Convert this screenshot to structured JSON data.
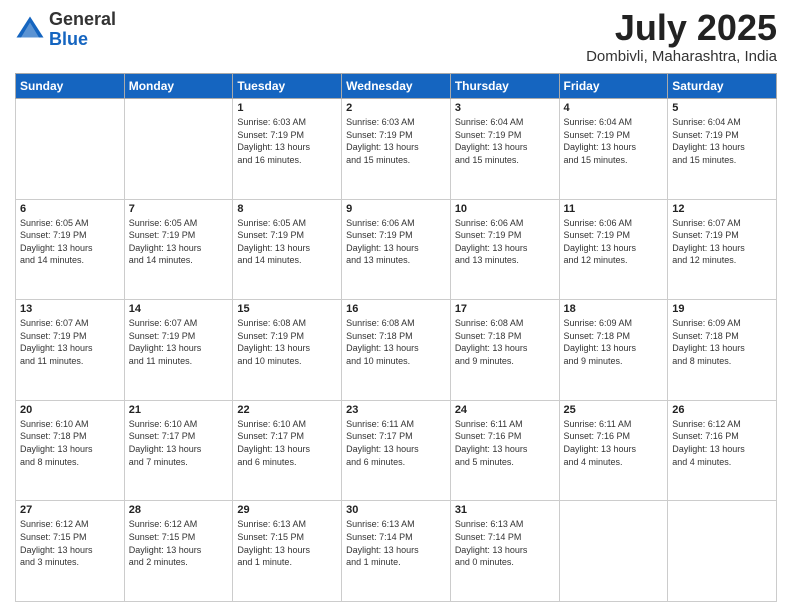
{
  "header": {
    "logo_general": "General",
    "logo_blue": "Blue",
    "month_year": "July 2025",
    "location": "Dombivli, Maharashtra, India"
  },
  "days_of_week": [
    "Sunday",
    "Monday",
    "Tuesday",
    "Wednesday",
    "Thursday",
    "Friday",
    "Saturday"
  ],
  "weeks": [
    [
      {
        "day": "",
        "info": ""
      },
      {
        "day": "",
        "info": ""
      },
      {
        "day": "1",
        "info": "Sunrise: 6:03 AM\nSunset: 7:19 PM\nDaylight: 13 hours\nand 16 minutes."
      },
      {
        "day": "2",
        "info": "Sunrise: 6:03 AM\nSunset: 7:19 PM\nDaylight: 13 hours\nand 15 minutes."
      },
      {
        "day": "3",
        "info": "Sunrise: 6:04 AM\nSunset: 7:19 PM\nDaylight: 13 hours\nand 15 minutes."
      },
      {
        "day": "4",
        "info": "Sunrise: 6:04 AM\nSunset: 7:19 PM\nDaylight: 13 hours\nand 15 minutes."
      },
      {
        "day": "5",
        "info": "Sunrise: 6:04 AM\nSunset: 7:19 PM\nDaylight: 13 hours\nand 15 minutes."
      }
    ],
    [
      {
        "day": "6",
        "info": "Sunrise: 6:05 AM\nSunset: 7:19 PM\nDaylight: 13 hours\nand 14 minutes."
      },
      {
        "day": "7",
        "info": "Sunrise: 6:05 AM\nSunset: 7:19 PM\nDaylight: 13 hours\nand 14 minutes."
      },
      {
        "day": "8",
        "info": "Sunrise: 6:05 AM\nSunset: 7:19 PM\nDaylight: 13 hours\nand 14 minutes."
      },
      {
        "day": "9",
        "info": "Sunrise: 6:06 AM\nSunset: 7:19 PM\nDaylight: 13 hours\nand 13 minutes."
      },
      {
        "day": "10",
        "info": "Sunrise: 6:06 AM\nSunset: 7:19 PM\nDaylight: 13 hours\nand 13 minutes."
      },
      {
        "day": "11",
        "info": "Sunrise: 6:06 AM\nSunset: 7:19 PM\nDaylight: 13 hours\nand 12 minutes."
      },
      {
        "day": "12",
        "info": "Sunrise: 6:07 AM\nSunset: 7:19 PM\nDaylight: 13 hours\nand 12 minutes."
      }
    ],
    [
      {
        "day": "13",
        "info": "Sunrise: 6:07 AM\nSunset: 7:19 PM\nDaylight: 13 hours\nand 11 minutes."
      },
      {
        "day": "14",
        "info": "Sunrise: 6:07 AM\nSunset: 7:19 PM\nDaylight: 13 hours\nand 11 minutes."
      },
      {
        "day": "15",
        "info": "Sunrise: 6:08 AM\nSunset: 7:19 PM\nDaylight: 13 hours\nand 10 minutes."
      },
      {
        "day": "16",
        "info": "Sunrise: 6:08 AM\nSunset: 7:18 PM\nDaylight: 13 hours\nand 10 minutes."
      },
      {
        "day": "17",
        "info": "Sunrise: 6:08 AM\nSunset: 7:18 PM\nDaylight: 13 hours\nand 9 minutes."
      },
      {
        "day": "18",
        "info": "Sunrise: 6:09 AM\nSunset: 7:18 PM\nDaylight: 13 hours\nand 9 minutes."
      },
      {
        "day": "19",
        "info": "Sunrise: 6:09 AM\nSunset: 7:18 PM\nDaylight: 13 hours\nand 8 minutes."
      }
    ],
    [
      {
        "day": "20",
        "info": "Sunrise: 6:10 AM\nSunset: 7:18 PM\nDaylight: 13 hours\nand 8 minutes."
      },
      {
        "day": "21",
        "info": "Sunrise: 6:10 AM\nSunset: 7:17 PM\nDaylight: 13 hours\nand 7 minutes."
      },
      {
        "day": "22",
        "info": "Sunrise: 6:10 AM\nSunset: 7:17 PM\nDaylight: 13 hours\nand 6 minutes."
      },
      {
        "day": "23",
        "info": "Sunrise: 6:11 AM\nSunset: 7:17 PM\nDaylight: 13 hours\nand 6 minutes."
      },
      {
        "day": "24",
        "info": "Sunrise: 6:11 AM\nSunset: 7:16 PM\nDaylight: 13 hours\nand 5 minutes."
      },
      {
        "day": "25",
        "info": "Sunrise: 6:11 AM\nSunset: 7:16 PM\nDaylight: 13 hours\nand 4 minutes."
      },
      {
        "day": "26",
        "info": "Sunrise: 6:12 AM\nSunset: 7:16 PM\nDaylight: 13 hours\nand 4 minutes."
      }
    ],
    [
      {
        "day": "27",
        "info": "Sunrise: 6:12 AM\nSunset: 7:15 PM\nDaylight: 13 hours\nand 3 minutes."
      },
      {
        "day": "28",
        "info": "Sunrise: 6:12 AM\nSunset: 7:15 PM\nDaylight: 13 hours\nand 2 minutes."
      },
      {
        "day": "29",
        "info": "Sunrise: 6:13 AM\nSunset: 7:15 PM\nDaylight: 13 hours\nand 1 minute."
      },
      {
        "day": "30",
        "info": "Sunrise: 6:13 AM\nSunset: 7:14 PM\nDaylight: 13 hours\nand 1 minute."
      },
      {
        "day": "31",
        "info": "Sunrise: 6:13 AM\nSunset: 7:14 PM\nDaylight: 13 hours\nand 0 minutes."
      },
      {
        "day": "",
        "info": ""
      },
      {
        "day": "",
        "info": ""
      }
    ]
  ]
}
